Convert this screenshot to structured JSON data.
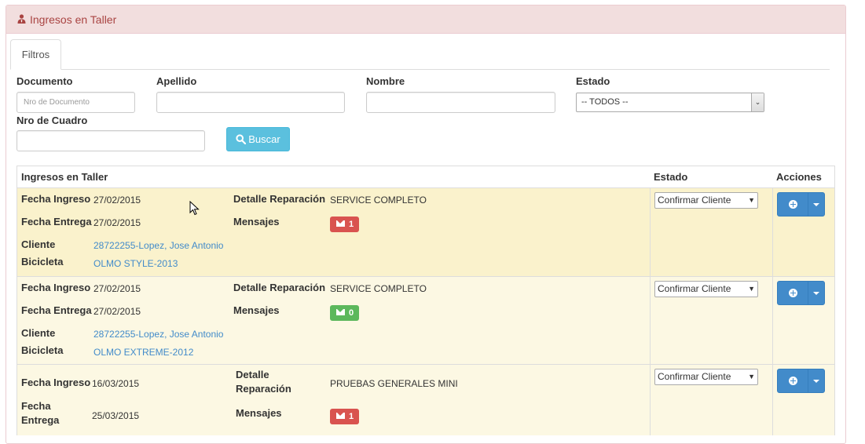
{
  "panel": {
    "title": "Ingresos en Taller",
    "icon": "user-tie-icon",
    "heading_color": "#a94442"
  },
  "tabs": [
    {
      "label": "Filtros",
      "active": true
    }
  ],
  "filters": {
    "documento": {
      "label": "Documento",
      "placeholder": "Nro de Documento",
      "value": ""
    },
    "apellido": {
      "label": "Apellido",
      "value": ""
    },
    "nombre": {
      "label": "Nombre",
      "value": ""
    },
    "estado": {
      "label": "Estado",
      "selected": "-- TODOS --"
    },
    "nro_cuadro": {
      "label": "Nro de Cuadro",
      "value": ""
    },
    "search_button": {
      "label": "Buscar",
      "icon": "search-icon",
      "color": "#5bc0de"
    }
  },
  "table": {
    "headers": {
      "main": "Ingresos en Taller",
      "estado": "Estado",
      "acciones": "Acciones"
    },
    "field_labels": {
      "fecha_ingreso": "Fecha Ingreso",
      "fecha_entrega": "Fecha Entrega",
      "cliente": "Cliente",
      "bicicleta": "Bicicleta",
      "detalle": "Detalle Reparación",
      "mensajes": "Mensajes",
      "fecha_ingreso_wrapped": "Fecha Ingreso",
      "fecha_entrega_l1": "Fecha",
      "fecha_entrega_l2": "Entrega",
      "detalle_l1": "Detalle",
      "detalle_l2": "Reparación"
    },
    "rows": [
      {
        "fecha_ingreso": "27/02/2015",
        "fecha_entrega": "27/02/2015",
        "cliente": "28722255-Lopez, Jose Antonio",
        "bicicleta": "OLMO STYLE-2013",
        "detalle": "SERVICE COMPLETO",
        "mensajes": "1",
        "mensajes_color": "#d9534f",
        "estado": "Confirmar Cliente",
        "highlight_color": "#faf2cc"
      },
      {
        "fecha_ingreso": "27/02/2015",
        "fecha_entrega": "27/02/2015",
        "cliente": "28722255-Lopez, Jose Antonio",
        "bicicleta": "OLMO EXTREME-2012",
        "detalle": "SERVICE COMPLETO",
        "mensajes": "0",
        "mensajes_color": "#5cb85c",
        "estado": "Confirmar Cliente",
        "highlight_color": "#fcf8e3"
      },
      {
        "fecha_ingreso": "16/03/2015",
        "fecha_entrega": "25/03/2015",
        "cliente": "",
        "bicicleta": "",
        "detalle": "PRUEBAS GENERALES MINI",
        "mensajes": "1",
        "mensajes_color": "#d9534f",
        "estado": "Confirmar Cliente",
        "highlight_color": "#fcf8e3"
      }
    ]
  },
  "action_button_color": "#428bca"
}
